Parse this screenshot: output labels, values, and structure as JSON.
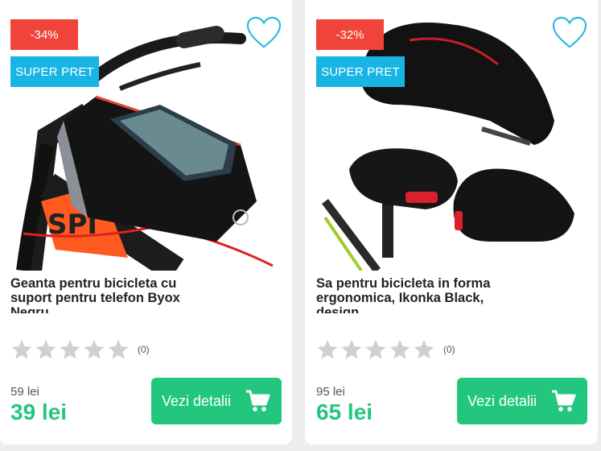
{
  "products": [
    {
      "discount": "-34%",
      "badge": "SUPER PRET",
      "title": "Geanta pentru bicicleta cu suport pentru telefon Byox Negru",
      "rating_count": "(0)",
      "old_price": "59 lei",
      "new_price": "39 lei",
      "button_label": "Vezi detalii"
    },
    {
      "discount": "-32%",
      "badge": "SUPER PRET",
      "title": "Sa pentru bicicleta in forma ergonomica, Ikonka Black, design",
      "rating_count": "(0)",
      "old_price": "95 lei",
      "new_price": "65 lei",
      "button_label": "Vezi detalii"
    }
  ],
  "colors": {
    "discount_red": "#f0433a",
    "super_pret_blue": "#18b4e4",
    "price_green": "#22c77d",
    "heart_outline": "#2bb5e3",
    "star_gray": "#d0d0d0"
  },
  "icons": {
    "wishlist": "heart-icon",
    "cart": "shopping-cart-icon",
    "rating": "star-icon"
  }
}
